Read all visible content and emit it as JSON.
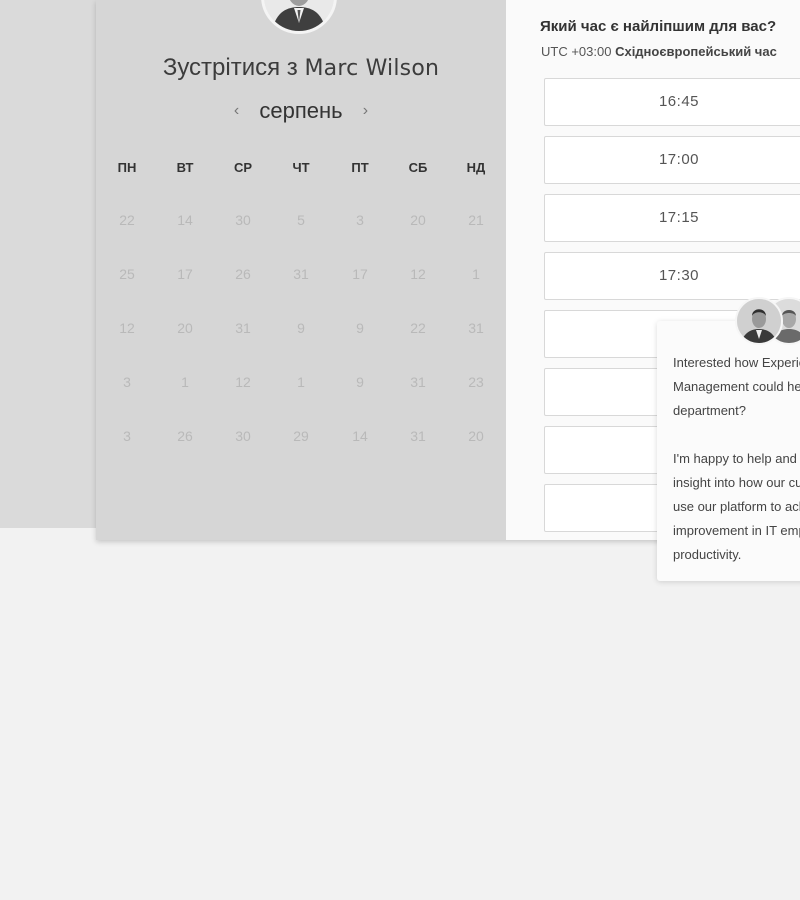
{
  "meeting": {
    "prefix": "Зустрітися з",
    "host_name": "Marc Wilson"
  },
  "calendar": {
    "month": "серпень",
    "prev_icon": "chevron-left-icon",
    "next_icon": "chevron-right-icon",
    "weekdays": [
      "ПН",
      "ВТ",
      "СР",
      "ЧТ",
      "ПТ",
      "СБ",
      "НД"
    ],
    "weeks": [
      [
        "22",
        "14",
        "30",
        "5",
        "3",
        "20",
        "21"
      ],
      [
        "25",
        "17",
        "26",
        "31",
        "17",
        "12",
        "1"
      ],
      [
        "12",
        "20",
        "31",
        "9",
        "9",
        "22",
        "31"
      ],
      [
        "3",
        "1",
        "12",
        "1",
        "9",
        "31",
        "23"
      ],
      [
        "3",
        "26",
        "30",
        "29",
        "14",
        "31",
        "20"
      ]
    ]
  },
  "times": {
    "question": "Який час є найліпшим для вас?",
    "tz_offset": "UTC +03:00",
    "tz_name": "Східноєвропейський час",
    "slots": [
      "16:45",
      "17:00",
      "17:15",
      "17:30",
      "",
      "",
      "",
      ""
    ]
  },
  "chat": {
    "message_1": [
      "Interested how Experience",
      "Management could help your",
      "department?"
    ],
    "message_2": [
      "I'm happy to help and share",
      "insight into how our customers",
      "use our platform to achieve",
      "improvement in IT employee",
      "productivity."
    ]
  },
  "colors": {
    "page_bg": "#f2f2f2",
    "calendar_bg": "#d6d6d6",
    "times_bg": "#fafafa",
    "day_text": "#b9b9b9"
  }
}
